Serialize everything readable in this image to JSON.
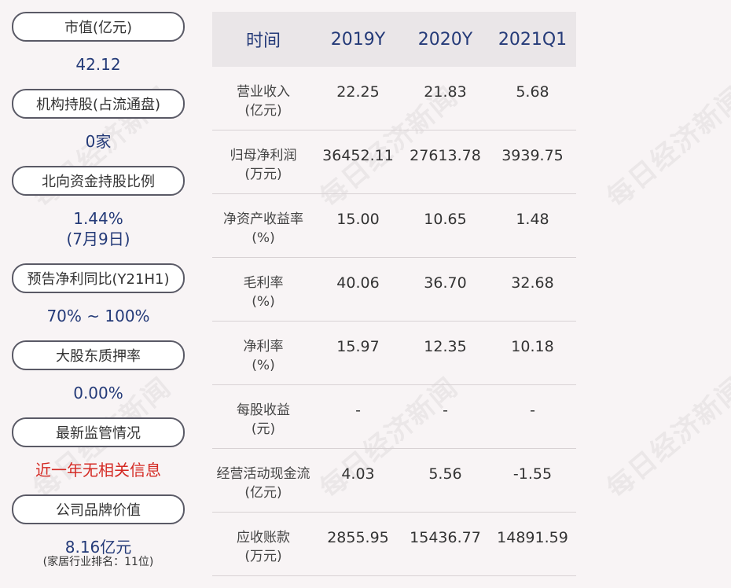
{
  "left": {
    "items": [
      {
        "label": "市值(亿元)",
        "value": "42.12"
      },
      {
        "label": "机构持股(占流通盘)",
        "value": "0家"
      },
      {
        "label": "北向资金持股比例",
        "value": "1.44%",
        "value2": "(7月9日)"
      },
      {
        "label": "预告净利同比(Y21H1)",
        "value": "70% ~ 100%"
      },
      {
        "label": "大股东质押率",
        "value": "0.00%"
      },
      {
        "label": "最新监管情况",
        "value": "近一年无相关信息"
      },
      {
        "label": "公司品牌价值",
        "value": "8.16亿元",
        "note": "(家居行业排名：11位)"
      }
    ]
  },
  "table": {
    "headers": [
      "时间",
      "2019Y",
      "2020Y",
      "2021Q1"
    ],
    "rows": [
      {
        "label1": "营业收入",
        "label2": "(亿元)",
        "values": [
          "22.25",
          "21.83",
          "5.68"
        ]
      },
      {
        "label1": "归母净利润",
        "label2": "(万元)",
        "values": [
          "36452.11",
          "27613.78",
          "3939.75"
        ]
      },
      {
        "label1": "净资产收益率",
        "label2": "(%)",
        "values": [
          "15.00",
          "10.65",
          "1.48"
        ]
      },
      {
        "label1": "毛利率",
        "label2": "(%)",
        "values": [
          "40.06",
          "36.70",
          "32.68"
        ]
      },
      {
        "label1": "净利率",
        "label2": "(%)",
        "values": [
          "15.97",
          "12.35",
          "10.18"
        ]
      },
      {
        "label1": "每股收益",
        "label2": "(元)",
        "values": [
          "-",
          "-",
          "-"
        ]
      },
      {
        "label1": "经营活动现金流",
        "label2": "(亿元)",
        "values": [
          "4.03",
          "5.56",
          "-1.55"
        ]
      },
      {
        "label1": "应收账款",
        "label2": "(万元)",
        "values": [
          "2855.95",
          "15436.77",
          "14891.59"
        ]
      }
    ]
  },
  "watermark": "每日经济新闻",
  "colors": {
    "accent": "#243a78",
    "alert": "#d42a24"
  }
}
